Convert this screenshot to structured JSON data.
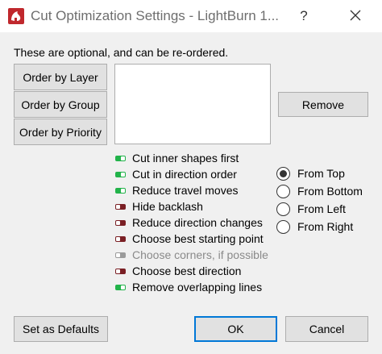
{
  "window": {
    "title": "Cut Optimization Settings - LightBurn 1...",
    "help_label": "?"
  },
  "description": "These are optional, and can be re-ordered.",
  "order_buttons": [
    {
      "label": "Order by Layer"
    },
    {
      "label": "Order by Group"
    },
    {
      "label": "Order by Priority"
    }
  ],
  "order_list": [],
  "remove_label": "Remove",
  "options": [
    {
      "label": "Cut inner shapes first",
      "enabled": true,
      "disabled": false
    },
    {
      "label": "Cut in direction order",
      "enabled": true,
      "disabled": false
    },
    {
      "label": "Reduce travel moves",
      "enabled": true,
      "disabled": false
    },
    {
      "label": "Hide backlash",
      "enabled": false,
      "disabled": false
    },
    {
      "label": "Reduce direction changes",
      "enabled": false,
      "disabled": false
    },
    {
      "label": "Choose best starting point",
      "enabled": false,
      "disabled": false
    },
    {
      "label": "Choose corners, if possible",
      "enabled": false,
      "disabled": true
    },
    {
      "label": "Choose best direction",
      "enabled": false,
      "disabled": false
    },
    {
      "label": "Remove overlapping lines",
      "enabled": true,
      "disabled": false
    }
  ],
  "direction": {
    "selected": "From Top",
    "options": [
      "From Top",
      "From Bottom",
      "From Left",
      "From Right"
    ]
  },
  "footer": {
    "defaults_label": "Set as Defaults",
    "ok_label": "OK",
    "cancel_label": "Cancel"
  },
  "colors": {
    "toggle_on": "#22b34a",
    "toggle_off": "#7a1f24",
    "toggle_disabled": "#9a9a9a",
    "accent": "#0078d7"
  }
}
